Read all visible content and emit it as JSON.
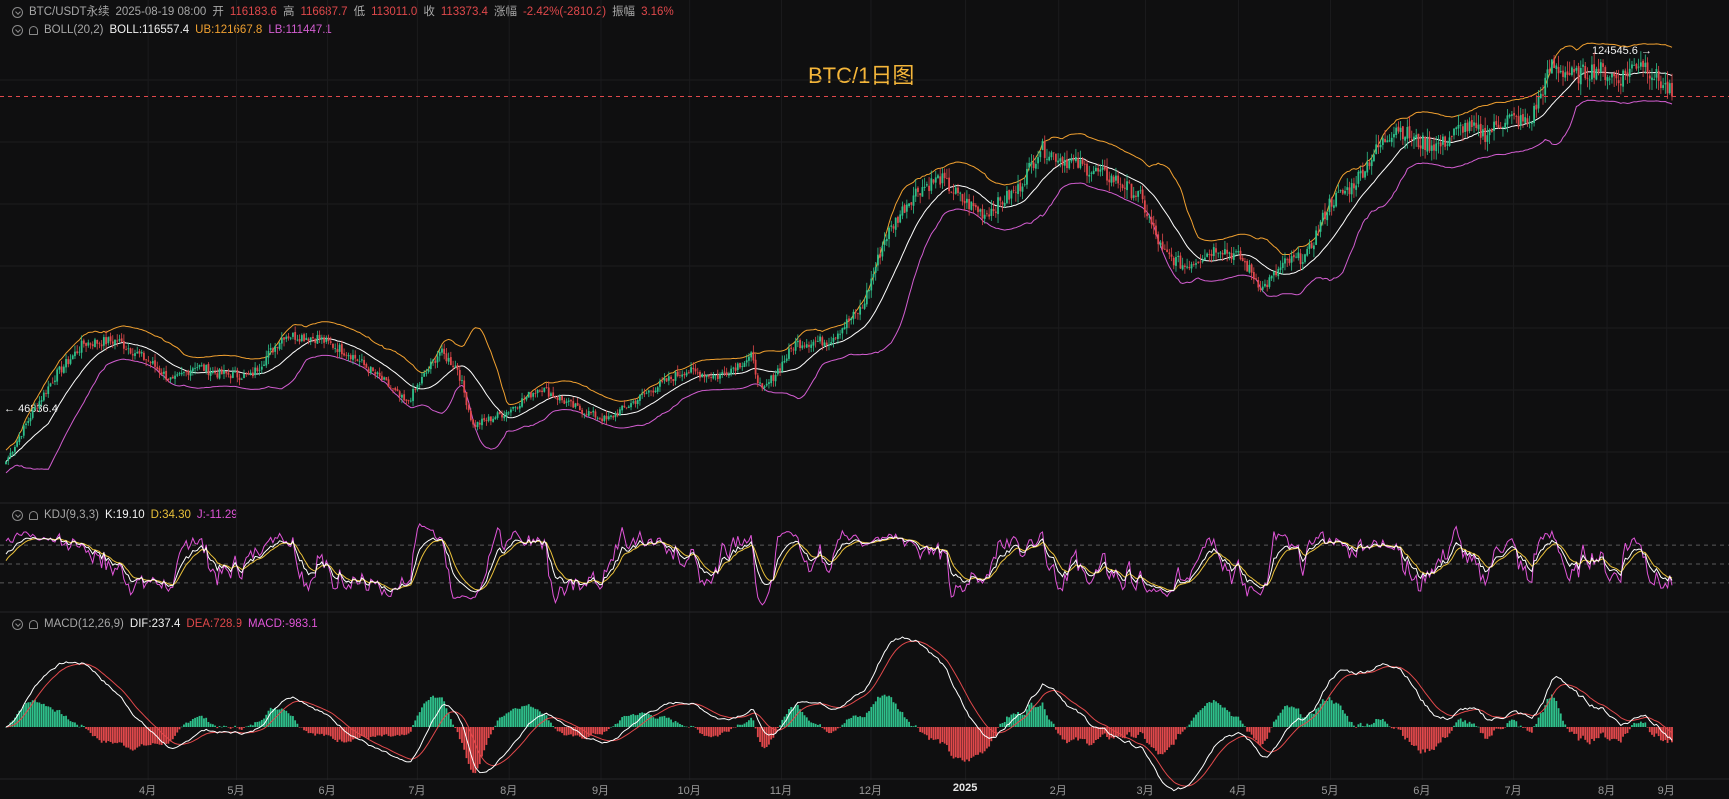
{
  "header": {
    "symbol": "BTC/USDT永续",
    "datetime": "2025-08-19 08:00",
    "open_label": "开",
    "open": "116183.6",
    "high_label": "高",
    "high": "116687.7",
    "low_label": "低",
    "low": "113011.0",
    "close_label": "收",
    "close": "113373.4",
    "change_label": "涨幅",
    "change": "-2.42%(-2810.2)",
    "amp_label": "振幅",
    "amp": "3.16%"
  },
  "boll": {
    "name": "BOLL(20,2)",
    "mid": "BOLL:116557.4",
    "ub": "UB:121667.8",
    "lb": "LB:111447.1"
  },
  "kdj": {
    "name": "KDJ(9,3,3)",
    "k": "K:19.10",
    "d": "D:34.30",
    "j": "J:-11.29"
  },
  "macd": {
    "name": "MACD(12,26,9)",
    "dif": "DIF:237.4",
    "dea": "DEA:728.9",
    "macd": "MACD:-983.1"
  },
  "chart_data": {
    "type": "candlestick",
    "title": "BTC/1日图",
    "high_marker": "124545.6",
    "low_marker": "46836.4",
    "x_ticks": [
      "4月",
      "5月",
      "6月",
      "7月",
      "8月",
      "9月",
      "10月",
      "11月",
      "12月",
      "2025",
      "2月",
      "3月",
      "4月",
      "5月",
      "6月",
      "7月",
      "8月",
      "9月"
    ],
    "anchors": [
      [
        0,
        47000
      ],
      [
        12,
        56000
      ],
      [
        22,
        62500
      ],
      [
        35,
        68500
      ],
      [
        50,
        69000
      ],
      [
        65,
        65000
      ],
      [
        75,
        61500
      ],
      [
        85,
        64500
      ],
      [
        95,
        63000
      ],
      [
        110,
        62500
      ],
      [
        125,
        70000
      ],
      [
        140,
        69500
      ],
      [
        155,
        66500
      ],
      [
        170,
        61500
      ],
      [
        180,
        57500
      ],
      [
        195,
        67000
      ],
      [
        203,
        64000
      ],
      [
        210,
        53500
      ],
      [
        225,
        56000
      ],
      [
        240,
        60500
      ],
      [
        255,
        57000
      ],
      [
        270,
        54500
      ],
      [
        290,
        60000
      ],
      [
        305,
        63500
      ],
      [
        320,
        62500
      ],
      [
        335,
        66000
      ],
      [
        340,
        59500
      ],
      [
        355,
        68500
      ],
      [
        370,
        69000
      ],
      [
        385,
        75000
      ],
      [
        395,
        87500
      ],
      [
        405,
        94000
      ],
      [
        410,
        96500
      ],
      [
        420,
        98500
      ],
      [
        430,
        94500
      ],
      [
        440,
        92000
      ],
      [
        455,
        96500
      ],
      [
        465,
        104000
      ],
      [
        475,
        102000
      ],
      [
        485,
        100500
      ],
      [
        500,
        98000
      ],
      [
        510,
        95000
      ],
      [
        520,
        85000
      ],
      [
        530,
        82500
      ],
      [
        545,
        86000
      ],
      [
        555,
        84000
      ],
      [
        565,
        78500
      ],
      [
        575,
        83000
      ],
      [
        585,
        84500
      ],
      [
        595,
        94000
      ],
      [
        605,
        97000
      ],
      [
        615,
        103000
      ],
      [
        625,
        108000
      ],
      [
        635,
        105000
      ],
      [
        645,
        104500
      ],
      [
        655,
        108000
      ],
      [
        665,
        106500
      ],
      [
        675,
        109500
      ],
      [
        685,
        108500
      ],
      [
        695,
        119000
      ],
      [
        705,
        117000
      ],
      [
        715,
        118500
      ],
      [
        725,
        116500
      ],
      [
        735,
        120000
      ],
      [
        745,
        115500
      ],
      [
        750,
        113373
      ]
    ],
    "kdj_ticks": [
      20,
      50,
      80
    ]
  },
  "colors": {
    "up": "#2ec08b",
    "down": "#e0484b",
    "mid": "#ffffff",
    "ub": "#f0a030",
    "lb": "#d25dd0",
    "k": "#ffffff",
    "d": "#e9c03a",
    "j": "#e055d8"
  }
}
